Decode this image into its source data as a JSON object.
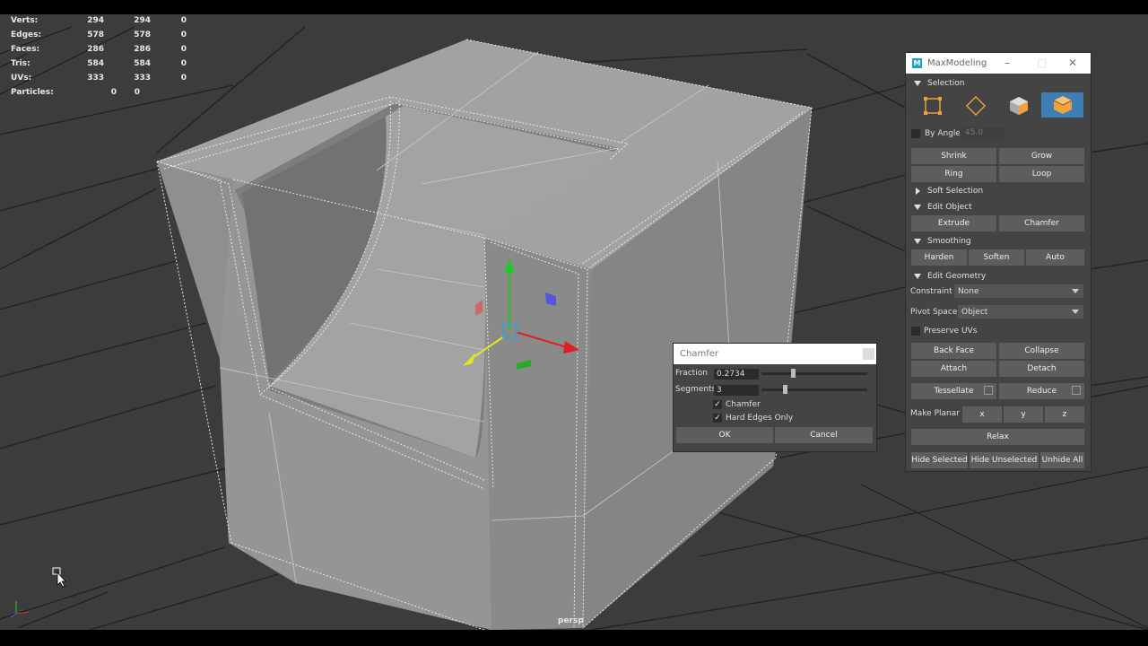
{
  "hud": {
    "rows": [
      {
        "label": "Verts:",
        "a": "294",
        "b": "294",
        "c": "0"
      },
      {
        "label": "Edges:",
        "a": "578",
        "b": "578",
        "c": "0"
      },
      {
        "label": "Faces:",
        "a": "286",
        "b": "286",
        "c": "0"
      },
      {
        "label": "Tris:",
        "a": "584",
        "b": "584",
        "c": "0"
      },
      {
        "label": "UVs:",
        "a": "333",
        "b": "333",
        "c": "0"
      }
    ],
    "particles": {
      "label": "Particles:",
      "a": "0",
      "b": "0"
    }
  },
  "viewport": {
    "camera_label": "persp"
  },
  "colors": {
    "viewport_bg": "#3c3c3c",
    "mesh": "#9a9a9a",
    "accent_blue": "#3d7fb5",
    "orange": "#f0a23c"
  },
  "maxmodeling": {
    "title": "MaxModeling",
    "selection": {
      "label": "Selection",
      "modes": [
        {
          "icon": "vertex-mode-icon"
        },
        {
          "icon": "edge-mode-icon"
        },
        {
          "icon": "face-mode-icon"
        },
        {
          "icon": "object-mode-icon",
          "active": true
        }
      ],
      "by_angle": "By Angle",
      "by_angle_value": "45.0",
      "shrink": "Shrink",
      "grow": "Grow",
      "ring": "Ring",
      "loop": "Loop"
    },
    "soft_selection": "Soft Selection",
    "edit_object": {
      "label": "Edit Object",
      "extrude": "Extrude",
      "chamfer": "Chamfer"
    },
    "smoothing": {
      "label": "Smoothing",
      "harden": "Harden",
      "soften": "Soften",
      "auto": "Auto"
    },
    "edit_geometry": {
      "label": "Edit Geometry",
      "constraint_label": "Constraint",
      "constraint_value": "None",
      "pivot_label": "Pivot Space",
      "pivot_value": "Object",
      "preserve_uvs": "Preserve UVs",
      "back_face": "Back Face",
      "collapse": "Collapse",
      "attach": "Attach",
      "detach": "Detach",
      "tessellate": "Tessellate",
      "reduce": "Reduce",
      "make_planar": "Make Planar",
      "x": "x",
      "y": "y",
      "z": "z",
      "relax": "Relax",
      "hide_selected": "Hide Selected",
      "hide_unselected": "Hide Unselected",
      "unhide_all": "Unhide All"
    }
  },
  "chamfer_dialog": {
    "title": "Chamfer",
    "fraction_label": "Fraction",
    "fraction_value": "0.2734",
    "fraction_level": 0.28,
    "segments_label": "Segments",
    "segments_value": "3",
    "segments_level": 0.2,
    "chamfer_check": "Chamfer",
    "hard_edges_check": "Hard Edges Only",
    "ok": "OK",
    "cancel": "Cancel"
  }
}
